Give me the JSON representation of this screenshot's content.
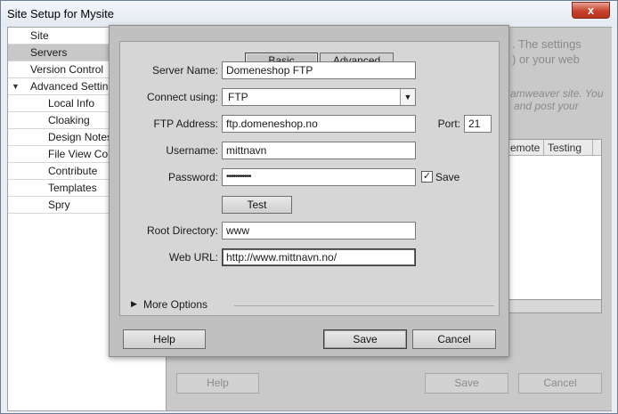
{
  "window": {
    "title": "Site Setup for Mysite",
    "close_glyph": "x"
  },
  "nav": {
    "items": [
      {
        "label": "Site",
        "indent": 0
      },
      {
        "label": "Servers",
        "indent": 0,
        "selected": true
      },
      {
        "label": "Version Control",
        "indent": 0
      },
      {
        "label": "Advanced Settings",
        "indent": 0,
        "expanded": true
      },
      {
        "label": "Local Info",
        "indent": 1
      },
      {
        "label": "Cloaking",
        "indent": 1
      },
      {
        "label": "Design Notes",
        "indent": 1
      },
      {
        "label": "File View Columns",
        "indent": 1
      },
      {
        "label": "Contribute",
        "indent": 1
      },
      {
        "label": "Templates",
        "indent": 1
      },
      {
        "label": "Spry",
        "indent": 1
      }
    ]
  },
  "background": {
    "text_line1": ". The settings",
    "text_line2": ") or your web",
    "italic_line1": "amweaver site. You",
    "italic_line2": "and post your",
    "table_col_remote": "emote",
    "table_col_testing": "Testing",
    "help_label": "Help",
    "save_label": "Save",
    "cancel_label": "Cancel"
  },
  "dialog": {
    "tabs": [
      {
        "label": "Basic",
        "active": true
      },
      {
        "label": "Advanced",
        "active": false
      }
    ],
    "fields": {
      "server_name": {
        "label": "Server Name:",
        "value": "Domeneshop FTP"
      },
      "connect_using": {
        "label": "Connect using:",
        "value": "FTP"
      },
      "ftp_address": {
        "label": "FTP Address:",
        "value": "ftp.domeneshop.no"
      },
      "port": {
        "label": "Port:",
        "value": "21"
      },
      "username": {
        "label": "Username:",
        "value": "mittnavn"
      },
      "password": {
        "label": "Password:",
        "value": "•••••••••••"
      },
      "save_password": {
        "label": "Save",
        "checked": true
      },
      "root_directory": {
        "label": "Root Directory:",
        "value": "www"
      },
      "web_url": {
        "label": "Web URL:",
        "value": "http://www.mittnavn.no/"
      }
    },
    "test_label": "Test",
    "more_options_label": "More Options",
    "help_label": "Help",
    "save_label": "Save",
    "cancel_label": "Cancel"
  }
}
